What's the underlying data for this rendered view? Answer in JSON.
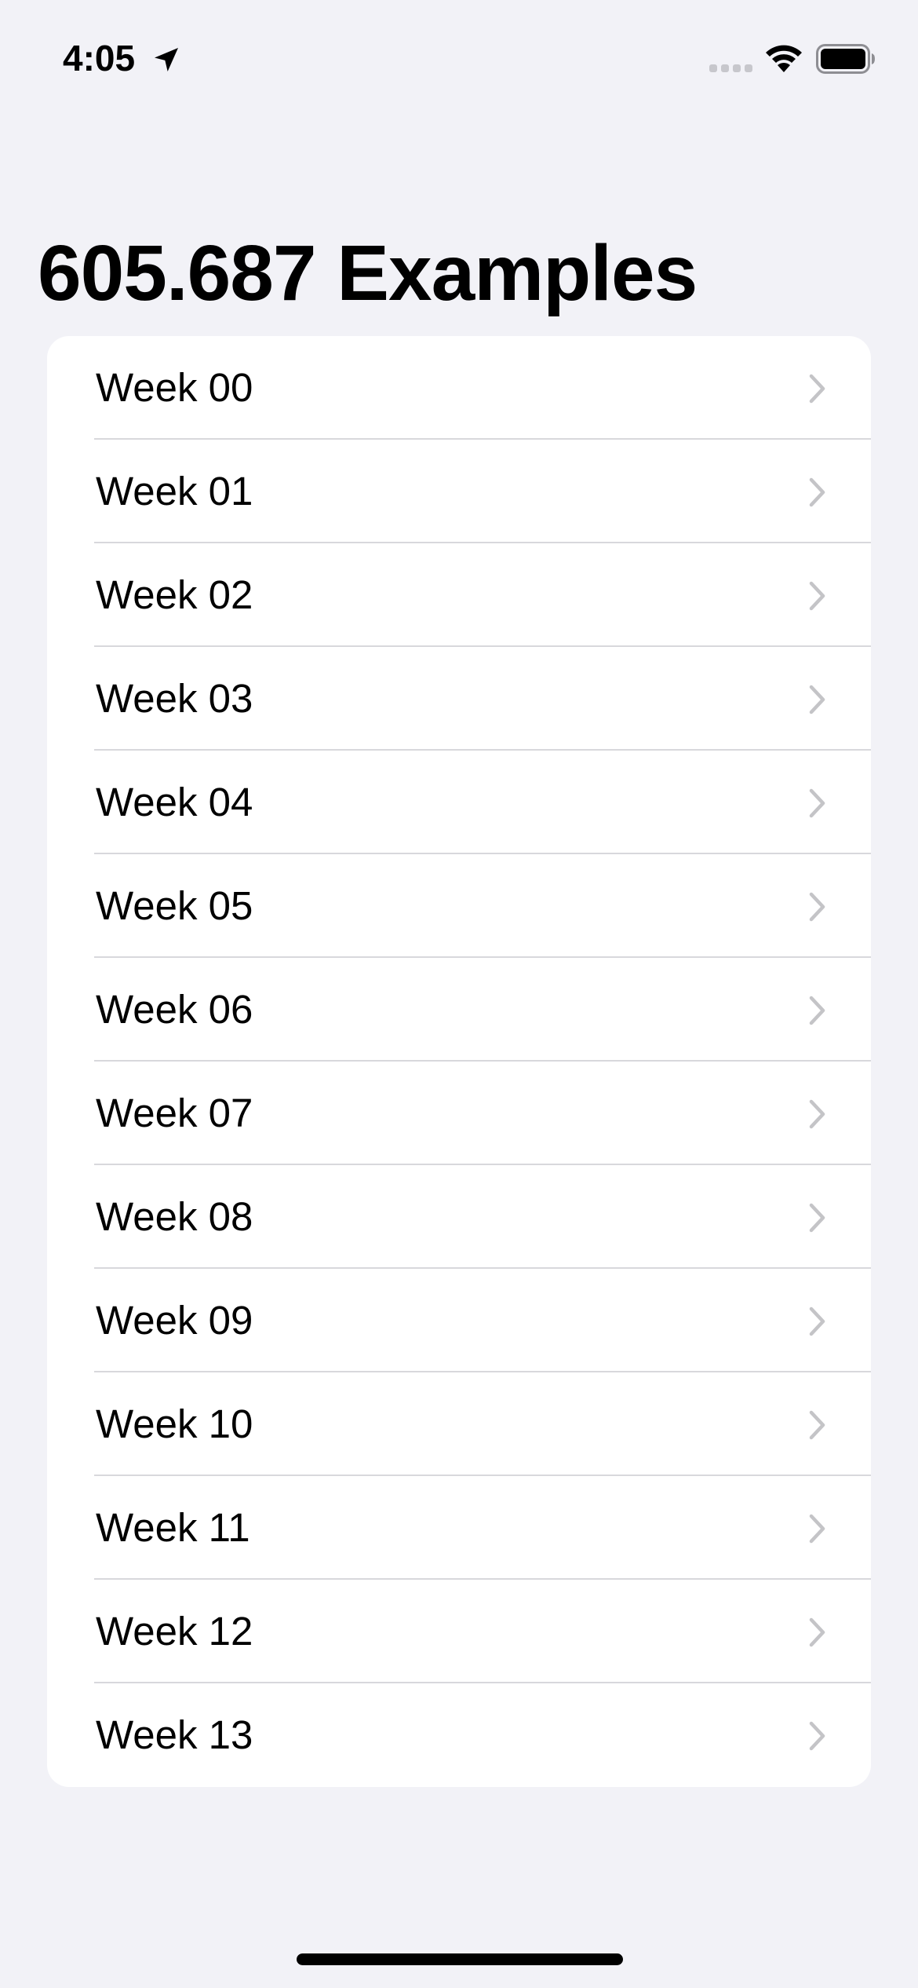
{
  "status_bar": {
    "time": "4:05",
    "icons": [
      "location-arrow-icon",
      "cellular-signal-icon",
      "wifi-icon",
      "battery-icon"
    ]
  },
  "title": "605.687 Examples",
  "list": {
    "items": [
      {
        "label": "Week 00"
      },
      {
        "label": "Week 01"
      },
      {
        "label": "Week 02"
      },
      {
        "label": "Week 03"
      },
      {
        "label": "Week 04"
      },
      {
        "label": "Week 05"
      },
      {
        "label": "Week 06"
      },
      {
        "label": "Week 07"
      },
      {
        "label": "Week 08"
      },
      {
        "label": "Week 09"
      },
      {
        "label": "Week 10"
      },
      {
        "label": "Week 11"
      },
      {
        "label": "Week 12"
      },
      {
        "label": "Week 13"
      }
    ],
    "disclosure_icon": "chevron-right-icon"
  },
  "colors": {
    "background": "#f2f2f7",
    "card": "#ffffff",
    "separator": "#d8d8dc",
    "chevron": "#c4c4c7",
    "text": "#000000"
  }
}
